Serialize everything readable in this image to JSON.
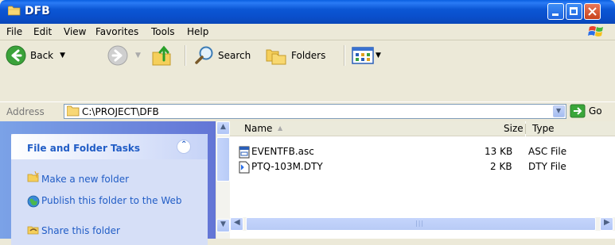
{
  "window": {
    "title": "DFB"
  },
  "menu": [
    "File",
    "Edit",
    "View",
    "Favorites",
    "Tools",
    "Help"
  ],
  "toolbar": {
    "back": "Back",
    "search": "Search",
    "folders": "Folders"
  },
  "address": {
    "label": "Address",
    "path": "C:\\PROJECT\\DFB",
    "go": "Go"
  },
  "tasks": {
    "title": "File and Folder Tasks",
    "items": [
      "Make a new folder",
      "Publish this folder to the Web",
      "Share this folder"
    ]
  },
  "columns": {
    "name": "Name",
    "size": "Size",
    "type": "Type"
  },
  "files": [
    {
      "name": "EVENTFB.asc",
      "size": "13 KB",
      "type": "ASC File"
    },
    {
      "name": "PTQ-103M.DTY",
      "size": "2 KB",
      "type": "DTY File"
    }
  ],
  "colors": {
    "titlebar": "#0a4fcc",
    "link": "#215dc6",
    "taskpane": "#6375d6"
  },
  "icons": [
    "folder-icon",
    "back-arrow-icon",
    "forward-arrow-icon",
    "up-folder-icon",
    "search-icon",
    "folders-icon",
    "views-icon",
    "go-arrow-icon",
    "windows-logo-icon"
  ]
}
